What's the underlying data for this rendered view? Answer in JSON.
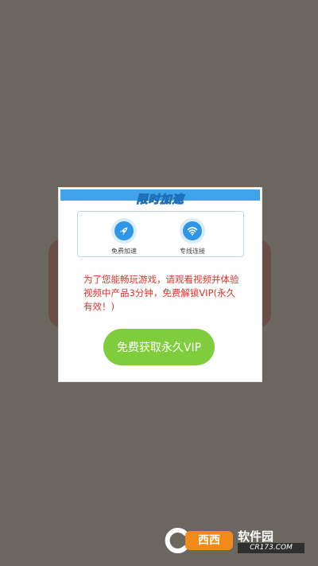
{
  "dialog": {
    "title": "限时加速",
    "features": [
      {
        "label": "免费加速",
        "icon": "rocket-icon"
      },
      {
        "label": "专线连接",
        "icon": "wifi-icon"
      }
    ],
    "notice": "为了您能畅玩游戏，请观看视频并体验视频中产品3分钟，免费解锁VIP(永久有效！)",
    "cta_label": "免费获取永久VIP"
  },
  "watermark": {
    "logo_text": "西西",
    "brand": "软件园",
    "domain": "CR173.COM"
  },
  "colors": {
    "overlay": "#6b6760",
    "header_blue": "#3fa3ea",
    "notice_red": "#e0312b",
    "cta_green": "#7fcc3c"
  }
}
